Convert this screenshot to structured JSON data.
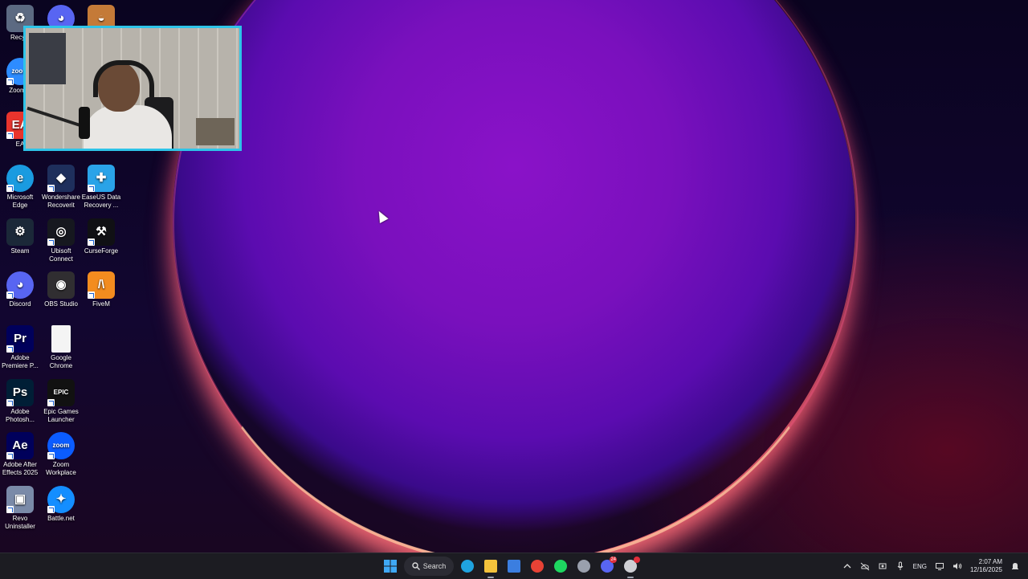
{
  "desktop": {
    "icons": [
      {
        "key": "recycle",
        "label": "Recycl",
        "bg": "#5c6a82",
        "glyph": "♻"
      },
      {
        "key": "discord_top",
        "label": "",
        "bg": "#5865f2",
        "glyph": "◕"
      },
      {
        "key": "bowl",
        "label": "",
        "bg": "#c47a38",
        "glyph": "◒"
      },
      {
        "key": "zoom_a",
        "label": "Zoom-a",
        "bg": "#2d8cff",
        "glyph": "zoom"
      },
      {
        "key": "ea",
        "label": "EA",
        "bg": "#e8342d",
        "glyph": "EA"
      },
      {
        "key": "edge",
        "label": "Microsoft Edge",
        "bg": "#1a9be0",
        "glyph": "e"
      },
      {
        "key": "recoverit",
        "label": "Wondershare Recoverit",
        "bg": "#1e2f5c",
        "glyph": "◆"
      },
      {
        "key": "easeus",
        "label": "EaseUS Data Recovery ...",
        "bg": "#2aa3e8",
        "glyph": "✚"
      },
      {
        "key": "steam",
        "label": "Steam",
        "bg": "#1b2838",
        "glyph": "⚙"
      },
      {
        "key": "ubisoft",
        "label": "Ubisoft Connect",
        "bg": "#16181f",
        "glyph": "◎"
      },
      {
        "key": "curseforge",
        "label": "CurseForge",
        "bg": "#101014",
        "glyph": "⚒"
      },
      {
        "key": "discord",
        "label": "Discord",
        "bg": "#5865f2",
        "glyph": "◕"
      },
      {
        "key": "obs",
        "label": "OBS Studio",
        "bg": "#302e31",
        "glyph": "◉"
      },
      {
        "key": "fivem",
        "label": "FiveM",
        "bg": "#f38c1f",
        "glyph": "/\\"
      },
      {
        "key": "premiere",
        "label": "Adobe Premiere P...",
        "bg": "#00005b",
        "glyph": "Pr"
      },
      {
        "key": "chrome_file",
        "label": "Google Chrome",
        "bg": "#f4f4f4",
        "glyph": ""
      },
      {
        "key": "photoshop",
        "label": "Adobe Photosh...",
        "bg": "#001e36",
        "glyph": "Ps"
      },
      {
        "key": "epic",
        "label": "Epic Games Launcher",
        "bg": "#111",
        "glyph": "EPIC"
      },
      {
        "key": "aftereffects",
        "label": "Adobe After Effects 2025",
        "bg": "#00005b",
        "glyph": "Ae"
      },
      {
        "key": "zoom",
        "label": "Zoom Workplace",
        "bg": "#0b5cff",
        "glyph": "zoom"
      },
      {
        "key": "revo",
        "label": "Revo Uninstaller",
        "bg": "#7a8aa8",
        "glyph": "▣"
      },
      {
        "key": "battlenet",
        "label": "Battle.net",
        "bg": "#148eff",
        "glyph": "✦"
      }
    ]
  },
  "taskbar": {
    "search_label": "Search",
    "apps": [
      {
        "name": "edge",
        "color": "#1fa3e0"
      },
      {
        "name": "file-explorer",
        "color": "#f3c23c"
      },
      {
        "name": "store",
        "color": "#3b7ee0"
      },
      {
        "name": "chrome",
        "color": "#e84235"
      },
      {
        "name": "spotify",
        "color": "#1ed760"
      },
      {
        "name": "settings",
        "color": "#9aa0ad"
      },
      {
        "name": "discord",
        "color": "#5865f2",
        "badge": "24"
      },
      {
        "name": "obs",
        "color": "#cfcfd4",
        "badge": ""
      }
    ],
    "tray": {
      "language": "ENG",
      "time": "2:07 AM",
      "date": "12/16/2025"
    }
  }
}
